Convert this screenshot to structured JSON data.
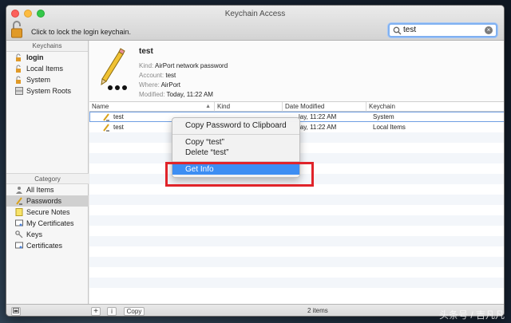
{
  "window": {
    "title": "Keychain Access"
  },
  "toolbar": {
    "lock_label": "Click to lock the login keychain."
  },
  "search": {
    "value": "test"
  },
  "sidebar": {
    "keychains_header": "Keychains",
    "keychains": [
      {
        "label": "login",
        "icon": "lock-open-icon",
        "bold": true
      },
      {
        "label": "Local Items",
        "icon": "lock-open-icon"
      },
      {
        "label": "System",
        "icon": "lock-open-icon"
      },
      {
        "label": "System Roots",
        "icon": "cabinet-icon"
      }
    ],
    "category_header": "Category",
    "categories": [
      {
        "label": "All Items",
        "icon": "people-icon"
      },
      {
        "label": "Passwords",
        "icon": "pencil-icon",
        "selected": true
      },
      {
        "label": "Secure Notes",
        "icon": "note-icon"
      },
      {
        "label": "My Certificates",
        "icon": "certificate-icon"
      },
      {
        "label": "Keys",
        "icon": "key-icon"
      },
      {
        "label": "Certificates",
        "icon": "certificate-icon"
      }
    ]
  },
  "detail": {
    "name": "test",
    "kind_label": "Kind:",
    "kind_value": "AirPort network password",
    "account_label": "Account:",
    "account_value": "test",
    "where_label": "Where:",
    "where_value": "AirPort",
    "modified_label": "Modified:",
    "modified_value": "Today, 11:22 AM"
  },
  "table": {
    "columns": [
      "Name",
      "Kind",
      "Date Modified",
      "Keychain"
    ],
    "rows": [
      {
        "name": "test",
        "date": "Today, 11:22 AM",
        "keychain": "System"
      },
      {
        "name": "test",
        "date": "Today, 11:22 AM",
        "keychain": "Local Items"
      }
    ],
    "date_visible": [
      "lay, 11:22 AM",
      "lay, 11:22 AM"
    ]
  },
  "context_menu": {
    "items": [
      "Copy Password to Clipboard",
      "Copy “test”",
      "Delete “test”",
      "Get Info"
    ],
    "active": "Get Info"
  },
  "bottom": {
    "add_label": "+",
    "info_label": "i",
    "copy_label": "Copy",
    "count": "2 items"
  },
  "watermark": "头条号 / 吉凡凡",
  "colors": {
    "accent": "#3d8ef3",
    "highlight": "#e0242a"
  }
}
